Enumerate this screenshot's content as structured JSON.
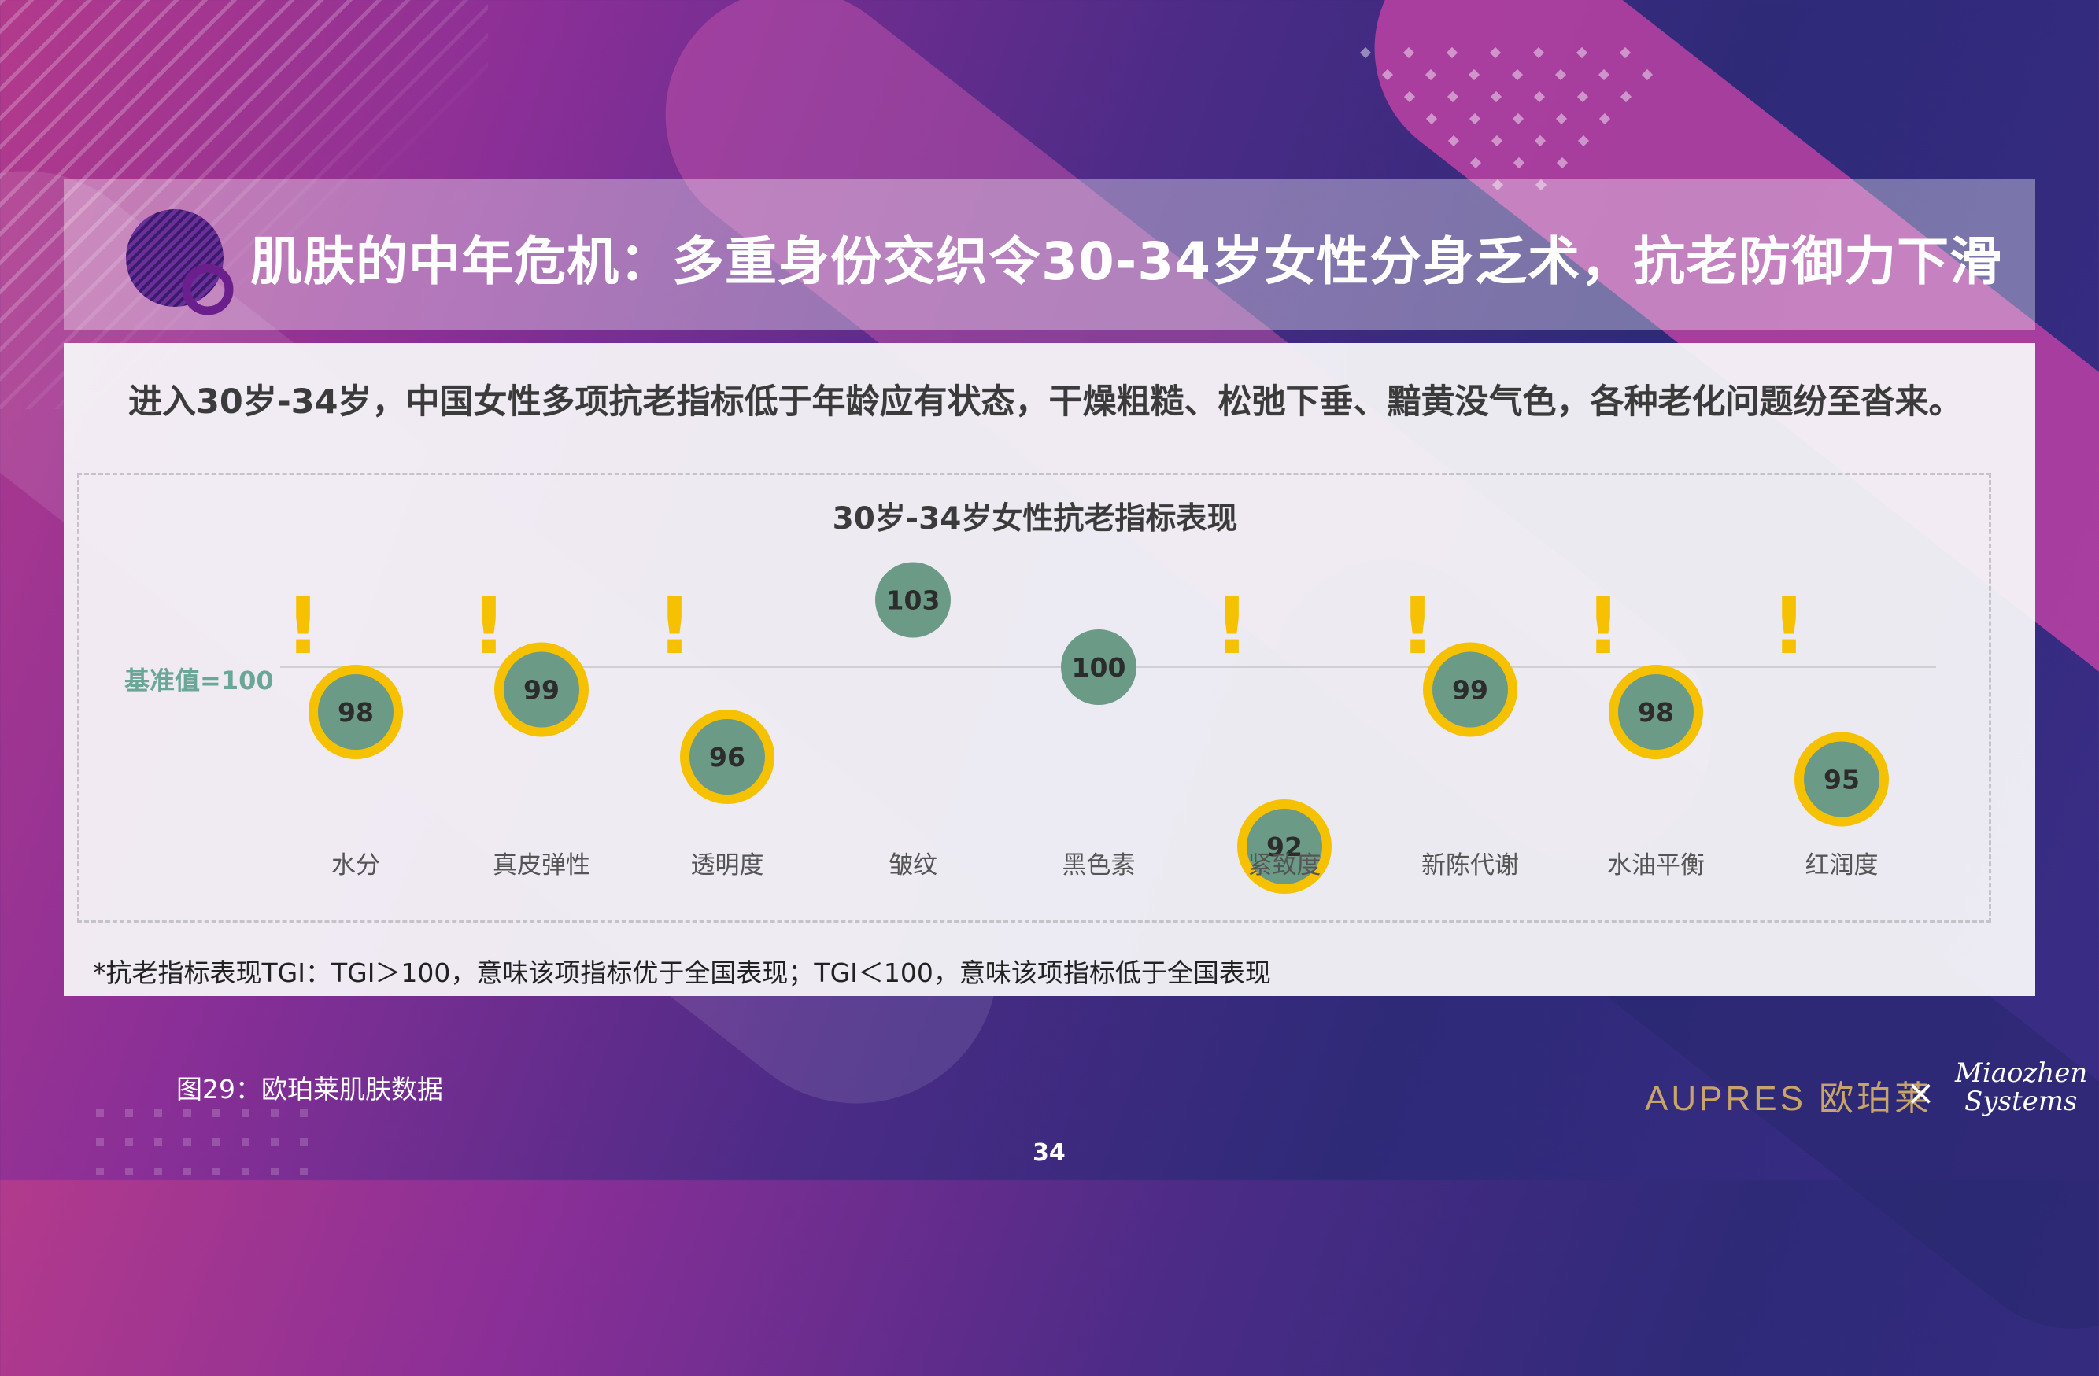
{
  "title": "肌肤的中年危机：多重身份交织令30-34岁女性分身乏术，抗老防御力下滑",
  "subtitle": "进入30岁-34岁，中国女性多项抗老指标低于年龄应有状态，干燥粗糙、松弛下垂、黯黄没气色，各种老化问题纷至沓来。",
  "chart_data": {
    "type": "scatter",
    "title": "30岁-34岁女性抗老指标表现",
    "baseline_label": "基准值=100",
    "baseline": 100,
    "categories": [
      "水分",
      "真皮弹性",
      "透明度",
      "皱纹",
      "黑色素",
      "紧致度",
      "新陈代谢",
      "水油平衡",
      "红润度"
    ],
    "values": [
      98,
      99,
      96,
      103,
      100,
      92,
      99,
      98,
      95
    ],
    "warning": [
      true,
      true,
      true,
      false,
      false,
      true,
      true,
      true,
      true
    ],
    "warning_mark": "!",
    "colors": {
      "point": "#6b9a87",
      "below_ring": "#f5c100",
      "baseline": "#d0d0d4",
      "label": "#555555"
    }
  },
  "footnote": "*抗老指标表现TGI：TGI＞100，意味该项指标优于全国表现；TGI＜100，意味该项指标低于全国表现",
  "figure_caption": "图29：欧珀莱肌肤数据",
  "page_number": "34",
  "brand": {
    "aupres": "AUPRES 欧珀莱",
    "separator": "×",
    "miaozhen_line1": "Miaozhen",
    "miaozhen_line2": "Systems"
  },
  "icons": {
    "title_icon": "striped-circle-ring-icon"
  }
}
